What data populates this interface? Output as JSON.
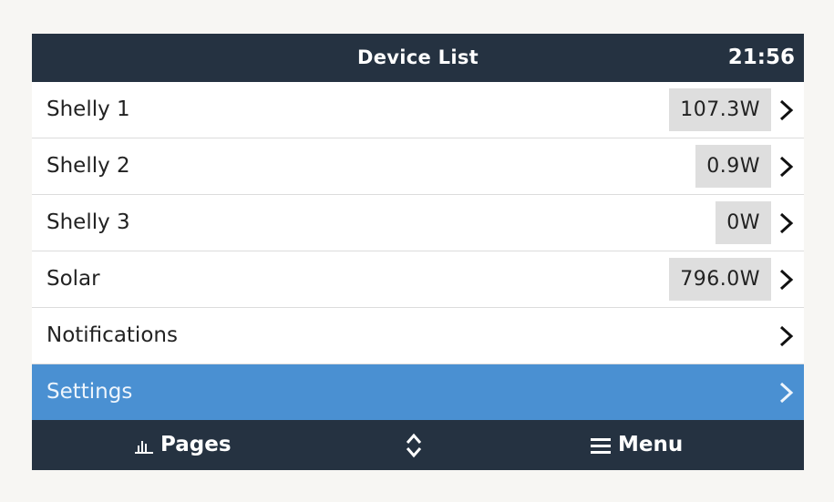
{
  "header": {
    "title": "Device List",
    "clock": "21:56"
  },
  "rows": [
    {
      "label": "Shelly 1",
      "value": "107.3W"
    },
    {
      "label": "Shelly 2",
      "value": "0.9W"
    },
    {
      "label": "Shelly 3",
      "value": "0W"
    },
    {
      "label": "Solar",
      "value": "796.0W"
    },
    {
      "label": "Notifications"
    },
    {
      "label": "Settings",
      "selected": true
    }
  ],
  "footer": {
    "pages_label": "Pages",
    "menu_label": "Menu",
    "pages_icon": "bar-chart-icon",
    "updown_icon": "up-down-chevron-icon",
    "menu_icon": "hamburger-icon"
  },
  "colors": {
    "header_bg": "#253241",
    "selected_bg": "#4a90d2",
    "value_bg": "#dedede"
  }
}
